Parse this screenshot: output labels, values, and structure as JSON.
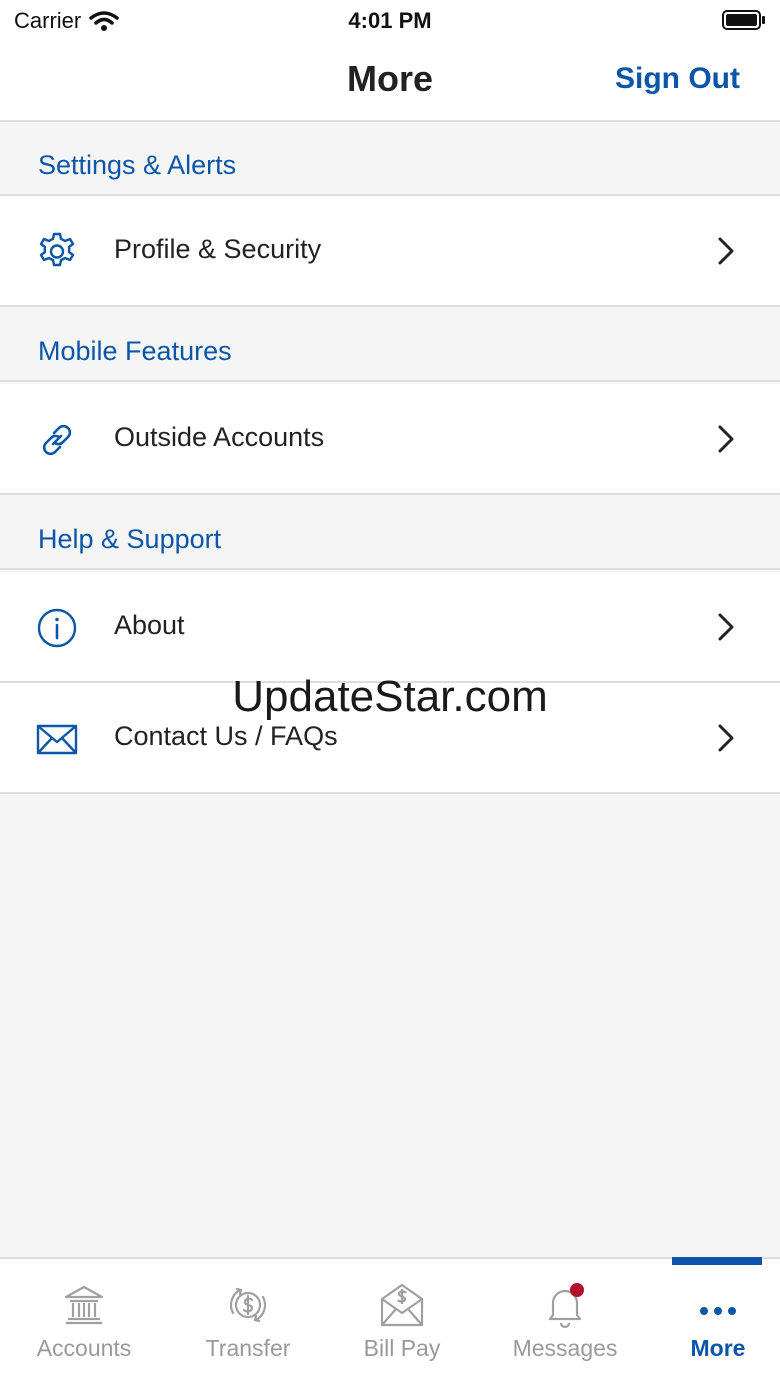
{
  "status_bar": {
    "carrier": "Carrier",
    "time": "4:01 PM"
  },
  "header": {
    "title": "More",
    "sign_out_label": "Sign Out"
  },
  "sections": [
    {
      "title": "Settings & Alerts",
      "items": [
        {
          "label": "Profile & Security",
          "icon": "gear-icon"
        }
      ]
    },
    {
      "title": "Mobile Features",
      "items": [
        {
          "label": "Outside Accounts",
          "icon": "link-icon"
        }
      ]
    },
    {
      "title": "Help & Support",
      "items": [
        {
          "label": "About",
          "icon": "info-icon"
        },
        {
          "label": "Contact Us / FAQs",
          "icon": "envelope-icon"
        }
      ]
    }
  ],
  "watermark": "UpdateStar.com",
  "tab_bar": {
    "tabs": [
      {
        "label": "Accounts",
        "icon": "bank-icon"
      },
      {
        "label": "Transfer",
        "icon": "transfer-icon"
      },
      {
        "label": "Bill Pay",
        "icon": "bill-pay-icon"
      },
      {
        "label": "Messages",
        "icon": "bell-icon"
      },
      {
        "label": "More",
        "icon": "more-icon"
      }
    ],
    "active_tab": "More"
  },
  "colors": {
    "accent": "#0b56a8",
    "inactive": "#9a9a9a",
    "badge": "#b0102d",
    "background": "#f5f5f5"
  }
}
